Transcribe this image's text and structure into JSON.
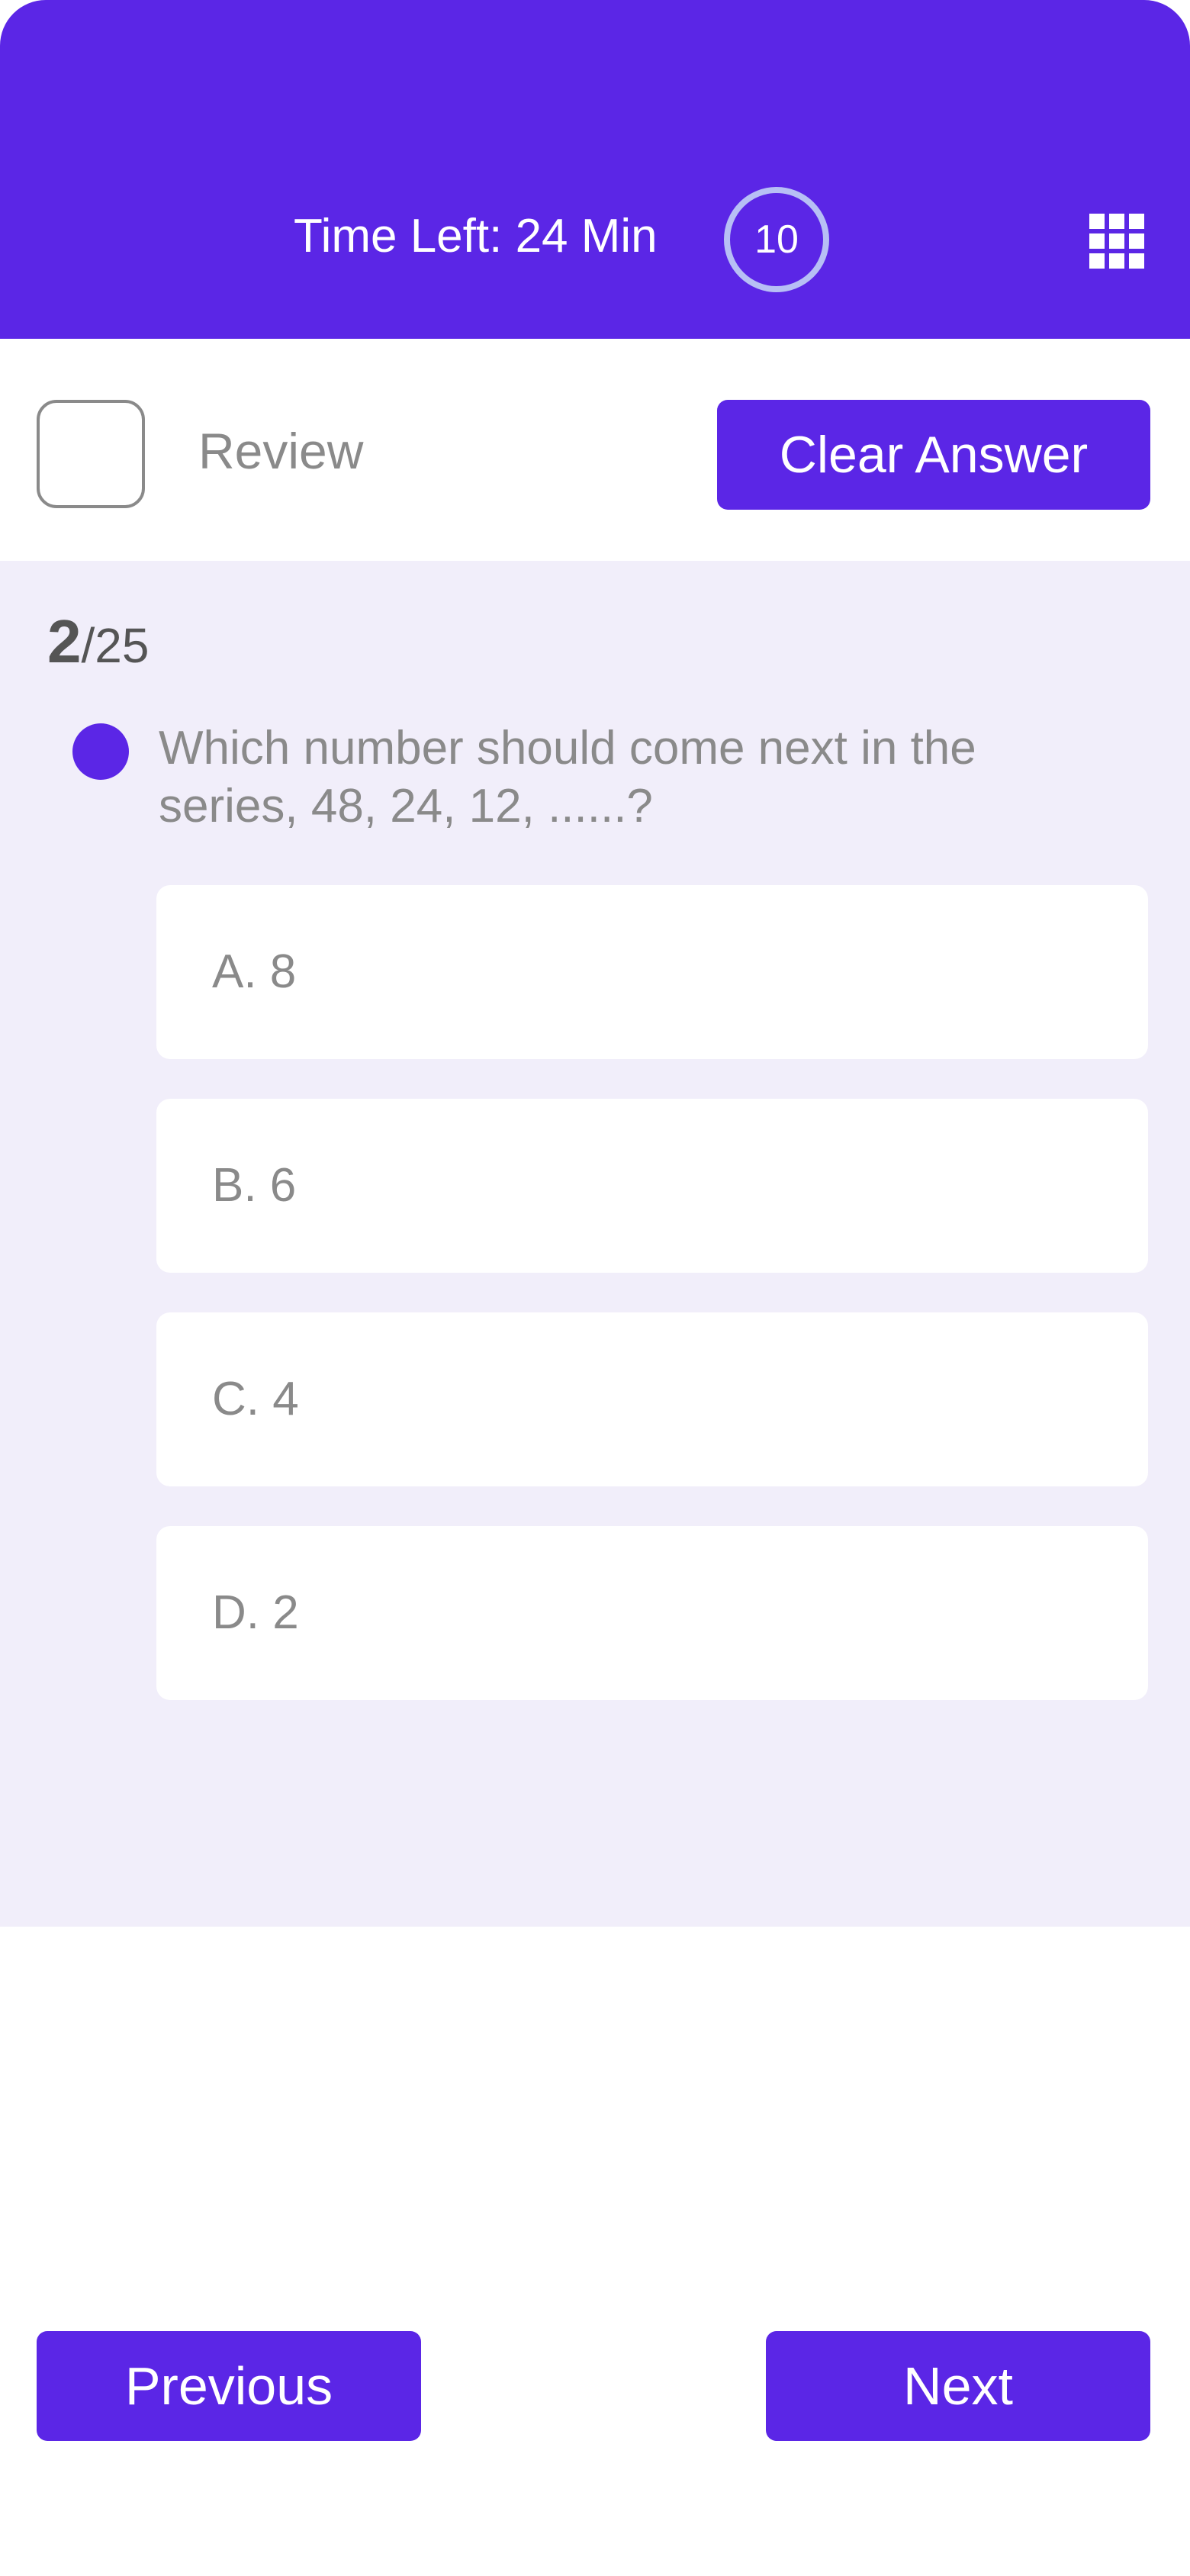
{
  "header": {
    "timer_text": "Time Left: 24 Min",
    "counter": "10",
    "grid_icon": "grid-icon",
    "color": "#5b26e6"
  },
  "review": {
    "label": "Review",
    "checked": false
  },
  "clear_answer_label": "Clear Answer",
  "question": {
    "current": "2",
    "total": "/25",
    "text": "Which number should come next in the series, 48, 24, 12, ......?",
    "options": [
      {
        "label": "A. 8"
      },
      {
        "label": "B. 6"
      },
      {
        "label": "C. 4"
      },
      {
        "label": "D. 2"
      }
    ]
  },
  "navigation": {
    "previous_label": "Previous",
    "next_label": "Next"
  },
  "colors": {
    "accent": "#5b26e6",
    "question_bg": "#f1eefa",
    "muted_text": "#8a8a8a",
    "ring": "#b7bff5"
  }
}
